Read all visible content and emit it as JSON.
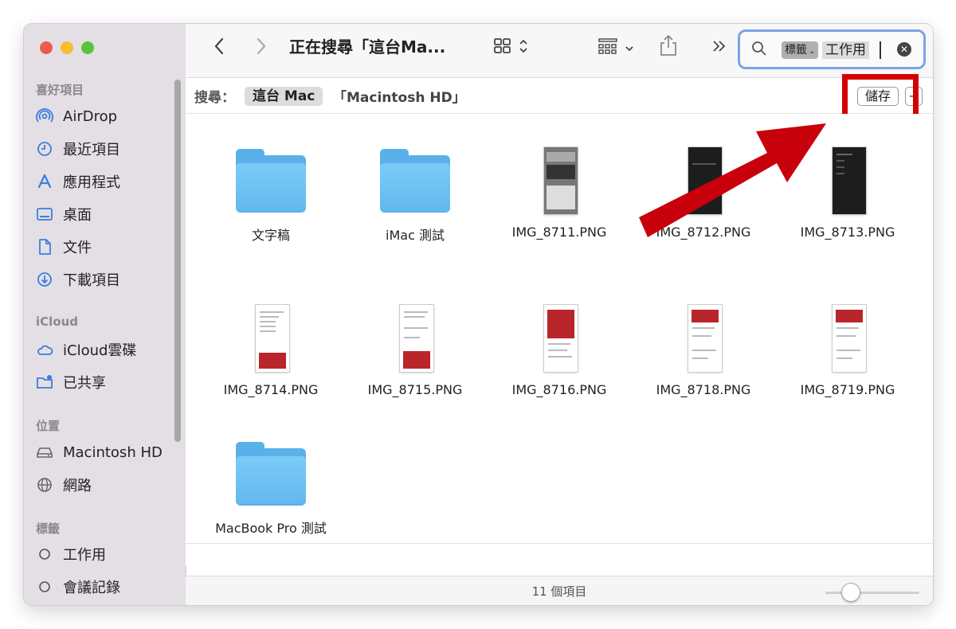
{
  "sidebar": {
    "sections": [
      {
        "title": "喜好項目",
        "items": [
          {
            "label": "AirDrop",
            "icon": "airdrop-icon"
          },
          {
            "label": "最近項目",
            "icon": "clock-icon"
          },
          {
            "label": "應用程式",
            "icon": "apps-icon"
          },
          {
            "label": "桌面",
            "icon": "desktop-icon"
          },
          {
            "label": "文件",
            "icon": "document-icon"
          },
          {
            "label": "下載項目",
            "icon": "download-icon"
          }
        ]
      },
      {
        "title": "iCloud",
        "items": [
          {
            "label": "iCloud雲碟",
            "icon": "cloud-icon"
          },
          {
            "label": "已共享",
            "icon": "shared-folder-icon"
          }
        ]
      },
      {
        "title": "位置",
        "items": [
          {
            "label": "Macintosh HD",
            "icon": "disk-icon"
          },
          {
            "label": "網路",
            "icon": "network-icon"
          }
        ]
      },
      {
        "title": "標籤",
        "items": [
          {
            "label": "工作用",
            "icon": "tag-circle-icon"
          },
          {
            "label": "會議記錄",
            "icon": "tag-circle-icon"
          }
        ]
      }
    ]
  },
  "toolbar": {
    "title": "正在搜尋「這台Ma...",
    "search": {
      "tag_chip": "標籤",
      "value": "工作用"
    }
  },
  "scope_bar": {
    "label": "搜尋：",
    "selected": "這台 Mac",
    "other": "「Macintosh HD」",
    "save_label": "儲存",
    "minus_label": "−"
  },
  "files": [
    {
      "name": "文字稿",
      "kind": "folder"
    },
    {
      "name": "iMac 測試",
      "kind": "folder"
    },
    {
      "name": "IMG_8711.PNG",
      "kind": "image-keyboard"
    },
    {
      "name": "IMG_8712.PNG",
      "kind": "image-dark"
    },
    {
      "name": "IMG_8713.PNG",
      "kind": "image-dark"
    },
    {
      "name": "IMG_8714.PNG",
      "kind": "image-list"
    },
    {
      "name": "IMG_8715.PNG",
      "kind": "image-list"
    },
    {
      "name": "IMG_8716.PNG",
      "kind": "image-red"
    },
    {
      "name": "IMG_8718.PNG",
      "kind": "image-red"
    },
    {
      "name": "IMG_8719.PNG",
      "kind": "image-red"
    },
    {
      "name": "MacBook Pro 測試",
      "kind": "folder"
    }
  ],
  "status": {
    "count": "11 個項目",
    "icon_size_level": 0.25
  },
  "colors": {
    "highlight": "#d40000",
    "folder": "#5ab1ea",
    "search_focus": "#7ea3e6"
  }
}
